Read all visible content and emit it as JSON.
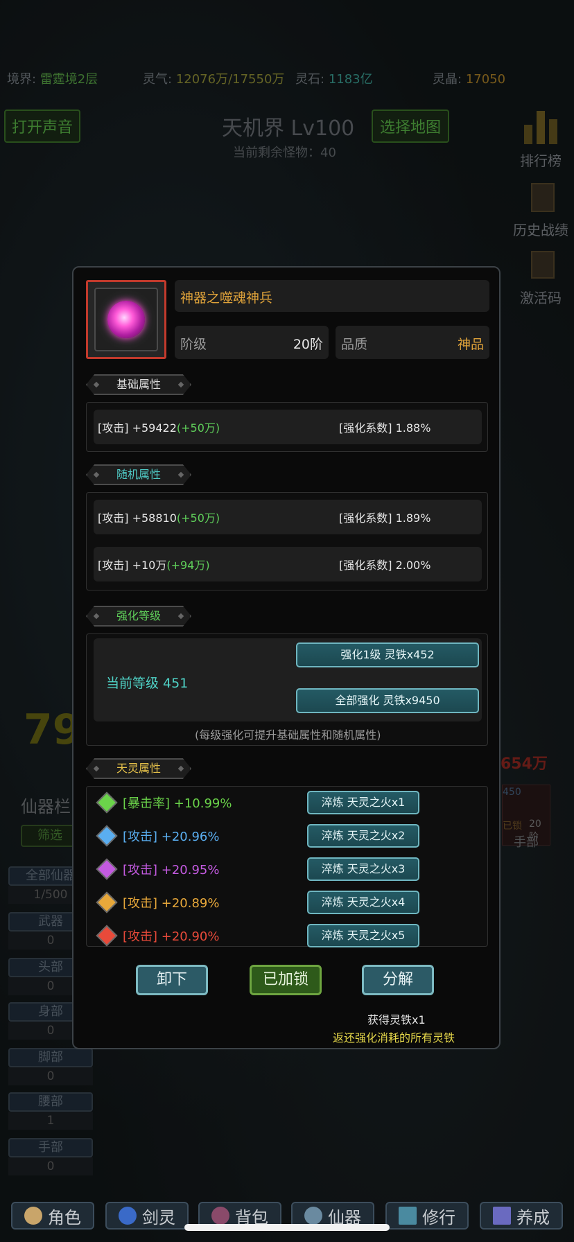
{
  "status": {
    "realm_label": "境界:",
    "realm_value": "雷霆境2层",
    "qi_label": "灵气:",
    "qi_value": "12076万/17550万",
    "stone_label": "灵石:",
    "stone_value": "1183亿",
    "crystal_label": "灵晶:",
    "crystal_value": "17050"
  },
  "top": {
    "sound_button": "打开声音",
    "map_title": "天机界 Lv100",
    "select_map_button": "选择地图",
    "remaining": "当前剩余怪物：40"
  },
  "side": {
    "ranking": "排行榜",
    "history": "历史战绩",
    "activation": "激活码"
  },
  "background": {
    "power_partial": "79",
    "power_right": "654万",
    "xianqi_label": "仙器栏",
    "filter_button": "筛选",
    "hand_slot": {
      "level": "450",
      "locked": "已锁",
      "stage": "20阶",
      "label": "手部"
    },
    "categories": [
      {
        "label": "全部仙器",
        "count": "1/500"
      },
      {
        "label": "武器",
        "count": "0"
      },
      {
        "label": "头部",
        "count": "0"
      },
      {
        "label": "身部",
        "count": "0"
      },
      {
        "label": "脚部",
        "count": "0"
      },
      {
        "label": "腰部",
        "count": "1"
      },
      {
        "label": "手部",
        "count": "0"
      }
    ]
  },
  "dialog": {
    "item_name": "神器之噬魂神兵",
    "rank_label": "阶级",
    "rank_value": "20阶",
    "quality_label": "品质",
    "quality_value": "神品",
    "base_tag": "基础属性",
    "base_attrs": [
      {
        "text": "[攻击] +59422",
        "plus": "(+50万)",
        "coef": "[强化系数] 1.88%"
      }
    ],
    "random_tag": "随机属性",
    "random_attrs": [
      {
        "text": "[攻击] +58810",
        "plus": "(+50万)",
        "coef": "[强化系数] 1.89%"
      },
      {
        "text": "[攻击] +10万",
        "plus": "(+94万)",
        "coef": "[强化系数] 2.00%"
      }
    ],
    "enhance_tag": "强化等级",
    "current_level": "当前等级 451",
    "enhance_one": "强化1级 灵铁x452",
    "enhance_all": "全部强化 灵铁x9450",
    "enhance_note": "(每级强化可提升基础属性和随机属性)",
    "spirit_tag": "天灵属性",
    "spirit_attrs": [
      {
        "text": "[暴击率] +10.99%",
        "button": "淬炼 天灵之火x1",
        "color": "#6bd44a"
      },
      {
        "text": "[攻击] +20.96%",
        "button": "淬炼 天灵之火x2",
        "color": "#5aaef0"
      },
      {
        "text": "[攻击] +20.95%",
        "button": "淬炼 天灵之火x3",
        "color": "#c35ae0"
      },
      {
        "text": "[攻击] +20.89%",
        "button": "淬炼 天灵之火x4",
        "color": "#e8a83a"
      },
      {
        "text": "[攻击] +20.90%",
        "button": "淬炼 天灵之火x5",
        "color": "#e84a3a"
      }
    ],
    "unequip_button": "卸下",
    "locked_button": "已加锁",
    "decompose_button": "分解",
    "obtain_text": "获得灵铁x1",
    "refund_text": "返还强化消耗的所有灵铁"
  },
  "nav": [
    {
      "label": "角色",
      "icon": "character-icon"
    },
    {
      "label": "剑灵",
      "icon": "sword-spirit-icon"
    },
    {
      "label": "背包",
      "icon": "bag-icon"
    },
    {
      "label": "仙器",
      "icon": "artifact-icon"
    },
    {
      "label": "修行",
      "icon": "cultivation-icon"
    },
    {
      "label": "养成",
      "icon": "nurture-icon"
    }
  ]
}
